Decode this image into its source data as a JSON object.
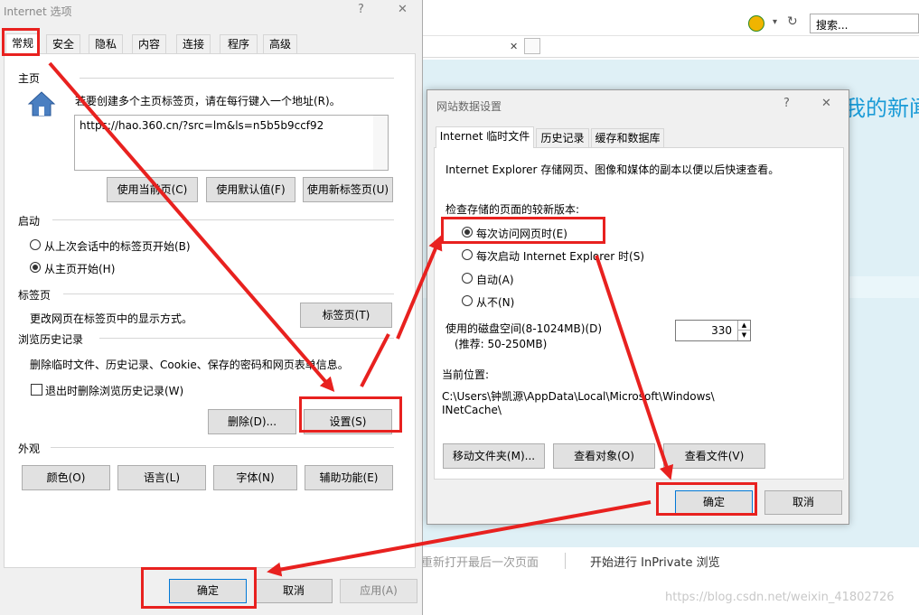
{
  "browser": {
    "search_placeholder": "搜索...",
    "heading_partial": "我的新闻",
    "reopen_last": "重新打开最后一次页面",
    "inprivate": "开始进行 InPrivate 浏览",
    "watermark": "https://blog.csdn.net/weixin_41802726"
  },
  "internet_options": {
    "title": "Internet 选项",
    "help": "?",
    "close": "✕",
    "tabs": [
      "常规",
      "安全",
      "隐私",
      "内容",
      "连接",
      "程序",
      "高级"
    ],
    "home": {
      "section": "主页",
      "instruction": "若要创建多个主页标签页，请在每行键入一个地址(R)。",
      "url": "https://hao.360.cn/?src=lm&ls=n5b5b9ccf92",
      "btn_current": "使用当前页(C)",
      "btn_default": "使用默认值(F)",
      "btn_newtab": "使用新标签页(U)"
    },
    "startup": {
      "section": "启动",
      "opt_last": "从上次会话中的标签页开始(B)",
      "opt_home": "从主页开始(H)"
    },
    "tabs_section": {
      "section": "标签页",
      "desc": "更改网页在标签页中的显示方式。",
      "btn": "标签页(T)"
    },
    "history": {
      "section": "浏览历史记录",
      "desc": "删除临时文件、历史记录、Cookie、保存的密码和网页表单信息。",
      "checkbox": "退出时删除浏览历史记录(W)",
      "btn_delete": "删除(D)...",
      "btn_settings": "设置(S)"
    },
    "appearance": {
      "section": "外观",
      "btn_colors": "颜色(O)",
      "btn_languages": "语言(L)",
      "btn_fonts": "字体(N)",
      "btn_accessibility": "辅助功能(E)"
    },
    "footer": {
      "ok": "确定",
      "cancel": "取消",
      "apply": "应用(A)"
    }
  },
  "website_data": {
    "title": "网站数据设置",
    "help": "?",
    "close": "✕",
    "tabs": [
      "Internet 临时文件",
      "历史记录",
      "缓存和数据库"
    ],
    "desc": "Internet Explorer 存储网页、图像和媒体的副本以便以后快速查看。",
    "check_label": "检查存储的页面的较新版本:",
    "options": [
      "每次访问网页时(E)",
      "每次启动 Internet Explorer 时(S)",
      "自动(A)",
      "从不(N)"
    ],
    "disk_label": "使用的磁盘空间(8-1024MB)(D)",
    "disk_recommend": "(推荐: 50-250MB)",
    "disk_value": "330",
    "location_label": "当前位置:",
    "location_line1": "C:\\Users\\钟凯源\\AppData\\Local\\Microsoft\\Windows\\",
    "location_line2": "INetCache\\",
    "btn_move": "移动文件夹(M)...",
    "btn_view_objects": "查看对象(O)",
    "btn_view_files": "查看文件(V)",
    "ok": "确定",
    "cancel": "取消"
  },
  "colors": {
    "annotation_red": "#e8211f",
    "browser_blue": "#1a9bd7"
  }
}
